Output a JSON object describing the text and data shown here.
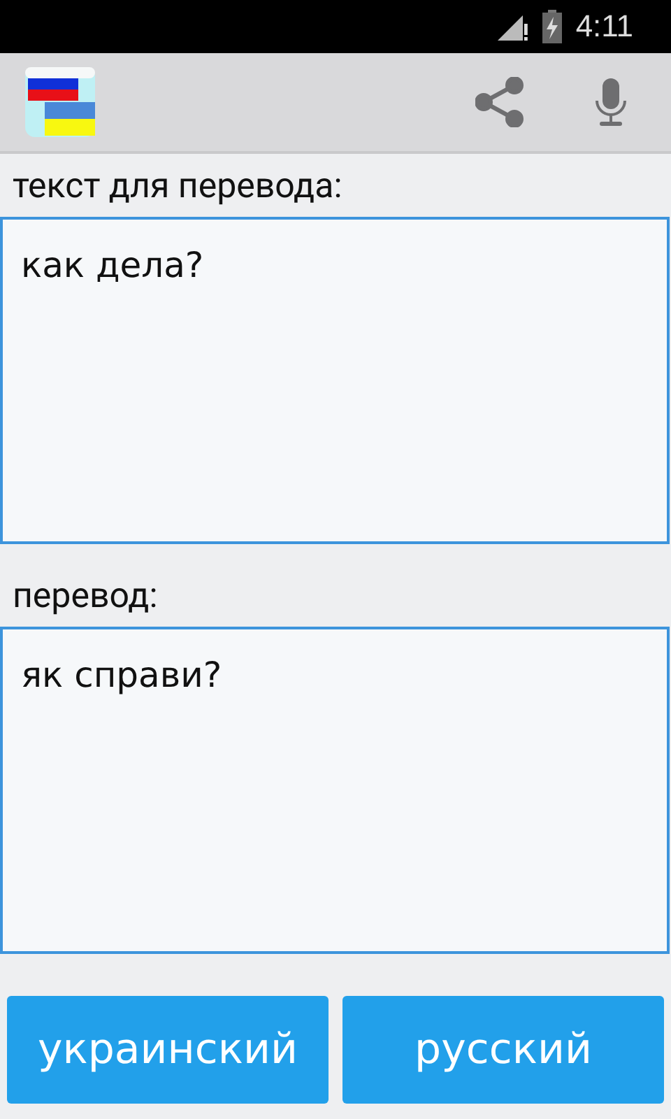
{
  "status_bar": {
    "time": "4:11"
  },
  "source": {
    "label": "текст для перевода:",
    "value": "как дела?"
  },
  "translation": {
    "label": "перевод:",
    "value": "як справи?"
  },
  "buttons": [
    {
      "label": "украинский"
    },
    {
      "label": "русский"
    }
  ]
}
